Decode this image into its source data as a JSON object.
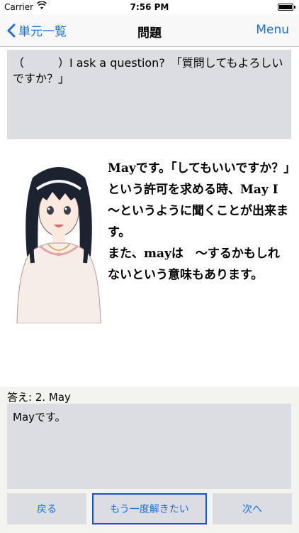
{
  "status": {
    "carrier": "Carrier",
    "time": "7:56 PM"
  },
  "nav": {
    "back_label": "単元一覧",
    "title": "問題",
    "menu_label": "Menu"
  },
  "question": {
    "text": "（　　　）I ask a question?　「質問してもよろしいですか？」"
  },
  "explanation": {
    "text": "Mayです。「してもいいですか？」という許可を求める時、May I ～というように聞くことが出来ます。\nまた、mayは　～するかもしれないという意味もあります。"
  },
  "answer": {
    "label": "答え: 2. May",
    "text": "Mayです。"
  },
  "buttons": {
    "back": "戻る",
    "retry": "もう一度解きたい",
    "next": "次へ"
  },
  "colors": {
    "accent": "#1a6fe0",
    "panel": "#dcdde3"
  }
}
